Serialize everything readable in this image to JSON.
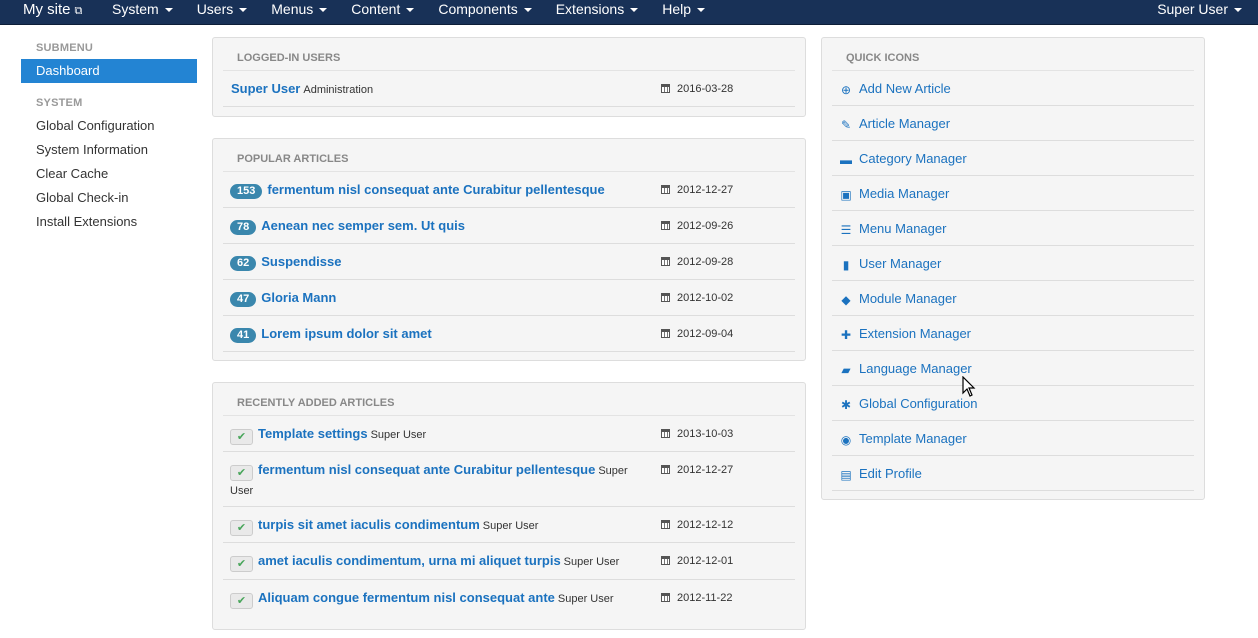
{
  "navbar": {
    "brand": "My site",
    "menu": [
      "System",
      "Users",
      "Menus",
      "Content",
      "Components",
      "Extensions",
      "Help"
    ],
    "user": "Super User"
  },
  "sidebar": {
    "submenu_heading": "SUBMENU",
    "dashboard": "Dashboard",
    "system_heading": "SYSTEM",
    "items": [
      "Global Configuration",
      "System Information",
      "Clear Cache",
      "Global Check-in",
      "Install Extensions"
    ]
  },
  "logged_in": {
    "heading": "LOGGED-IN USERS",
    "rows": [
      {
        "name": "Super User",
        "client": "Administration",
        "date": "2016-03-28"
      }
    ]
  },
  "popular": {
    "heading": "POPULAR ARTICLES",
    "rows": [
      {
        "hits": "153",
        "title": "fermentum nisl consequat ante Curabitur pellentesque",
        "date": "2012-12-27"
      },
      {
        "hits": "78",
        "title": "Aenean nec semper sem. Ut quis",
        "date": "2012-09-26"
      },
      {
        "hits": "62",
        "title": "Suspendisse",
        "date": "2012-09-28"
      },
      {
        "hits": "47",
        "title": "Gloria Mann",
        "date": "2012-10-02"
      },
      {
        "hits": "41",
        "title": "Lorem ipsum dolor sit amet",
        "date": "2012-09-04"
      }
    ]
  },
  "recent": {
    "heading": "RECENTLY ADDED ARTICLES",
    "rows": [
      {
        "title": "Template settings",
        "author": "Super User",
        "date": "2013-10-03"
      },
      {
        "title": "fermentum nisl consequat ante Curabitur pellentesque",
        "author": "Super User",
        "date": "2012-12-27"
      },
      {
        "title": "turpis sit amet iaculis condimentum",
        "author": "Super User",
        "date": "2012-12-12"
      },
      {
        "title": "amet iaculis condimentum, urna mi aliquet turpis",
        "author": "Super User",
        "date": "2012-12-01"
      },
      {
        "title": "Aliquam congue fermentum nisl consequat ante",
        "author": "Super User",
        "date": "2012-11-22"
      }
    ]
  },
  "quick_icons": {
    "heading": "QUICK ICONS",
    "items": [
      {
        "label": "Add New Article",
        "icon": "new-article-icon",
        "glyph": "⊕"
      },
      {
        "label": "Article Manager",
        "icon": "pencil-icon",
        "glyph": "✎"
      },
      {
        "label": "Category Manager",
        "icon": "folder-icon",
        "glyph": "▬"
      },
      {
        "label": "Media Manager",
        "icon": "image-icon",
        "glyph": "▣"
      },
      {
        "label": "Menu Manager",
        "icon": "list-icon",
        "glyph": "☰"
      },
      {
        "label": "User Manager",
        "icon": "user-icon",
        "glyph": "▮"
      },
      {
        "label": "Module Manager",
        "icon": "cube-icon",
        "glyph": "◆"
      },
      {
        "label": "Extension Manager",
        "icon": "puzzle-icon",
        "glyph": "✚"
      },
      {
        "label": "Language Manager",
        "icon": "comments-icon",
        "glyph": "▰"
      },
      {
        "label": "Global Configuration",
        "icon": "cog-icon",
        "glyph": "✱"
      },
      {
        "label": "Template Manager",
        "icon": "eye-icon",
        "glyph": "◉"
      },
      {
        "label": "Edit Profile",
        "icon": "vcard-icon",
        "glyph": "▤"
      }
    ]
  },
  "colors": {
    "navbar": "#183157",
    "accent": "#2384d3",
    "link": "#1b72bf",
    "badge": "#3a87ad"
  }
}
